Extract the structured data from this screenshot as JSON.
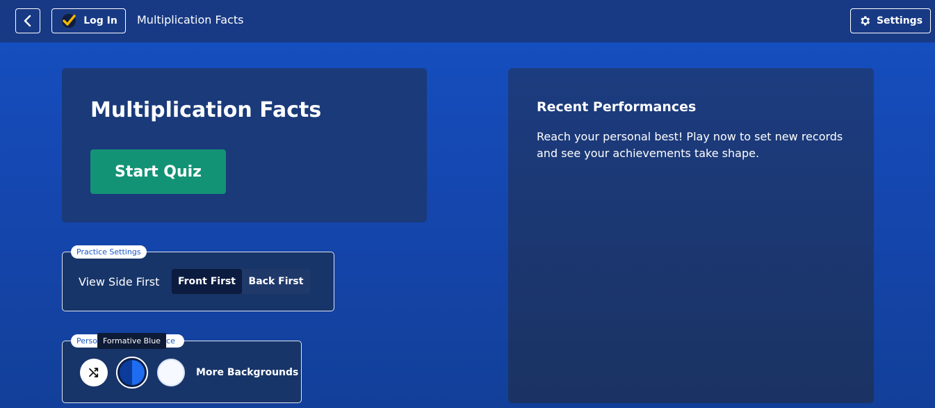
{
  "header": {
    "back_icon": "chevron-left-icon",
    "login_label": "Log In",
    "login_icon": "checkmark-badge-icon",
    "page_title": "Multiplication Facts",
    "settings_label": "Settings",
    "settings_icon": "gear-icon"
  },
  "hero": {
    "title": "Multiplication Facts",
    "start_label": "Start Quiz"
  },
  "recent": {
    "title": "Recent Performances",
    "message": "Reach your personal best! Play now to set new records and see your achievements take shape."
  },
  "practice_settings": {
    "legend": "Practice Settings",
    "view_side_label": "View Side First",
    "options": [
      "Front First",
      "Back First"
    ],
    "selected": "Front First"
  },
  "personalize": {
    "legend_visible": "Perso",
    "legend_visible_end": "ice",
    "shuffle_icon": "shuffle-icon",
    "tooltip": "Formative Blue",
    "more_label": "More Backgrounds"
  },
  "colors": {
    "header_bg": "#183a85",
    "panel_bg": "#1a3a7a",
    "start_button": "#139375",
    "accent_blue": "#1e6df0"
  }
}
